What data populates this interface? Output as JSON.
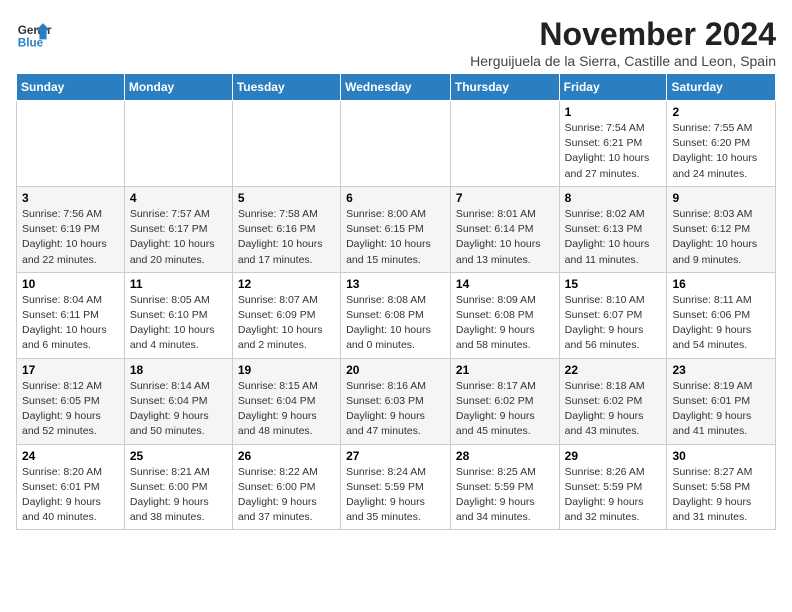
{
  "logo": {
    "line1": "General",
    "line2": "Blue"
  },
  "title": "November 2024",
  "subtitle": "Herguijuela de la Sierra, Castille and Leon, Spain",
  "weekdays": [
    "Sunday",
    "Monday",
    "Tuesday",
    "Wednesday",
    "Thursday",
    "Friday",
    "Saturday"
  ],
  "weeks": [
    [
      {
        "day": "",
        "info": ""
      },
      {
        "day": "",
        "info": ""
      },
      {
        "day": "",
        "info": ""
      },
      {
        "day": "",
        "info": ""
      },
      {
        "day": "",
        "info": ""
      },
      {
        "day": "1",
        "info": "Sunrise: 7:54 AM\nSunset: 6:21 PM\nDaylight: 10 hours and 27 minutes."
      },
      {
        "day": "2",
        "info": "Sunrise: 7:55 AM\nSunset: 6:20 PM\nDaylight: 10 hours and 24 minutes."
      }
    ],
    [
      {
        "day": "3",
        "info": "Sunrise: 7:56 AM\nSunset: 6:19 PM\nDaylight: 10 hours and 22 minutes."
      },
      {
        "day": "4",
        "info": "Sunrise: 7:57 AM\nSunset: 6:17 PM\nDaylight: 10 hours and 20 minutes."
      },
      {
        "day": "5",
        "info": "Sunrise: 7:58 AM\nSunset: 6:16 PM\nDaylight: 10 hours and 17 minutes."
      },
      {
        "day": "6",
        "info": "Sunrise: 8:00 AM\nSunset: 6:15 PM\nDaylight: 10 hours and 15 minutes."
      },
      {
        "day": "7",
        "info": "Sunrise: 8:01 AM\nSunset: 6:14 PM\nDaylight: 10 hours and 13 minutes."
      },
      {
        "day": "8",
        "info": "Sunrise: 8:02 AM\nSunset: 6:13 PM\nDaylight: 10 hours and 11 minutes."
      },
      {
        "day": "9",
        "info": "Sunrise: 8:03 AM\nSunset: 6:12 PM\nDaylight: 10 hours and 9 minutes."
      }
    ],
    [
      {
        "day": "10",
        "info": "Sunrise: 8:04 AM\nSunset: 6:11 PM\nDaylight: 10 hours and 6 minutes."
      },
      {
        "day": "11",
        "info": "Sunrise: 8:05 AM\nSunset: 6:10 PM\nDaylight: 10 hours and 4 minutes."
      },
      {
        "day": "12",
        "info": "Sunrise: 8:07 AM\nSunset: 6:09 PM\nDaylight: 10 hours and 2 minutes."
      },
      {
        "day": "13",
        "info": "Sunrise: 8:08 AM\nSunset: 6:08 PM\nDaylight: 10 hours and 0 minutes."
      },
      {
        "day": "14",
        "info": "Sunrise: 8:09 AM\nSunset: 6:08 PM\nDaylight: 9 hours and 58 minutes."
      },
      {
        "day": "15",
        "info": "Sunrise: 8:10 AM\nSunset: 6:07 PM\nDaylight: 9 hours and 56 minutes."
      },
      {
        "day": "16",
        "info": "Sunrise: 8:11 AM\nSunset: 6:06 PM\nDaylight: 9 hours and 54 minutes."
      }
    ],
    [
      {
        "day": "17",
        "info": "Sunrise: 8:12 AM\nSunset: 6:05 PM\nDaylight: 9 hours and 52 minutes."
      },
      {
        "day": "18",
        "info": "Sunrise: 8:14 AM\nSunset: 6:04 PM\nDaylight: 9 hours and 50 minutes."
      },
      {
        "day": "19",
        "info": "Sunrise: 8:15 AM\nSunset: 6:04 PM\nDaylight: 9 hours and 48 minutes."
      },
      {
        "day": "20",
        "info": "Sunrise: 8:16 AM\nSunset: 6:03 PM\nDaylight: 9 hours and 47 minutes."
      },
      {
        "day": "21",
        "info": "Sunrise: 8:17 AM\nSunset: 6:02 PM\nDaylight: 9 hours and 45 minutes."
      },
      {
        "day": "22",
        "info": "Sunrise: 8:18 AM\nSunset: 6:02 PM\nDaylight: 9 hours and 43 minutes."
      },
      {
        "day": "23",
        "info": "Sunrise: 8:19 AM\nSunset: 6:01 PM\nDaylight: 9 hours and 41 minutes."
      }
    ],
    [
      {
        "day": "24",
        "info": "Sunrise: 8:20 AM\nSunset: 6:01 PM\nDaylight: 9 hours and 40 minutes."
      },
      {
        "day": "25",
        "info": "Sunrise: 8:21 AM\nSunset: 6:00 PM\nDaylight: 9 hours and 38 minutes."
      },
      {
        "day": "26",
        "info": "Sunrise: 8:22 AM\nSunset: 6:00 PM\nDaylight: 9 hours and 37 minutes."
      },
      {
        "day": "27",
        "info": "Sunrise: 8:24 AM\nSunset: 5:59 PM\nDaylight: 9 hours and 35 minutes."
      },
      {
        "day": "28",
        "info": "Sunrise: 8:25 AM\nSunset: 5:59 PM\nDaylight: 9 hours and 34 minutes."
      },
      {
        "day": "29",
        "info": "Sunrise: 8:26 AM\nSunset: 5:59 PM\nDaylight: 9 hours and 32 minutes."
      },
      {
        "day": "30",
        "info": "Sunrise: 8:27 AM\nSunset: 5:58 PM\nDaylight: 9 hours and 31 minutes."
      }
    ]
  ]
}
